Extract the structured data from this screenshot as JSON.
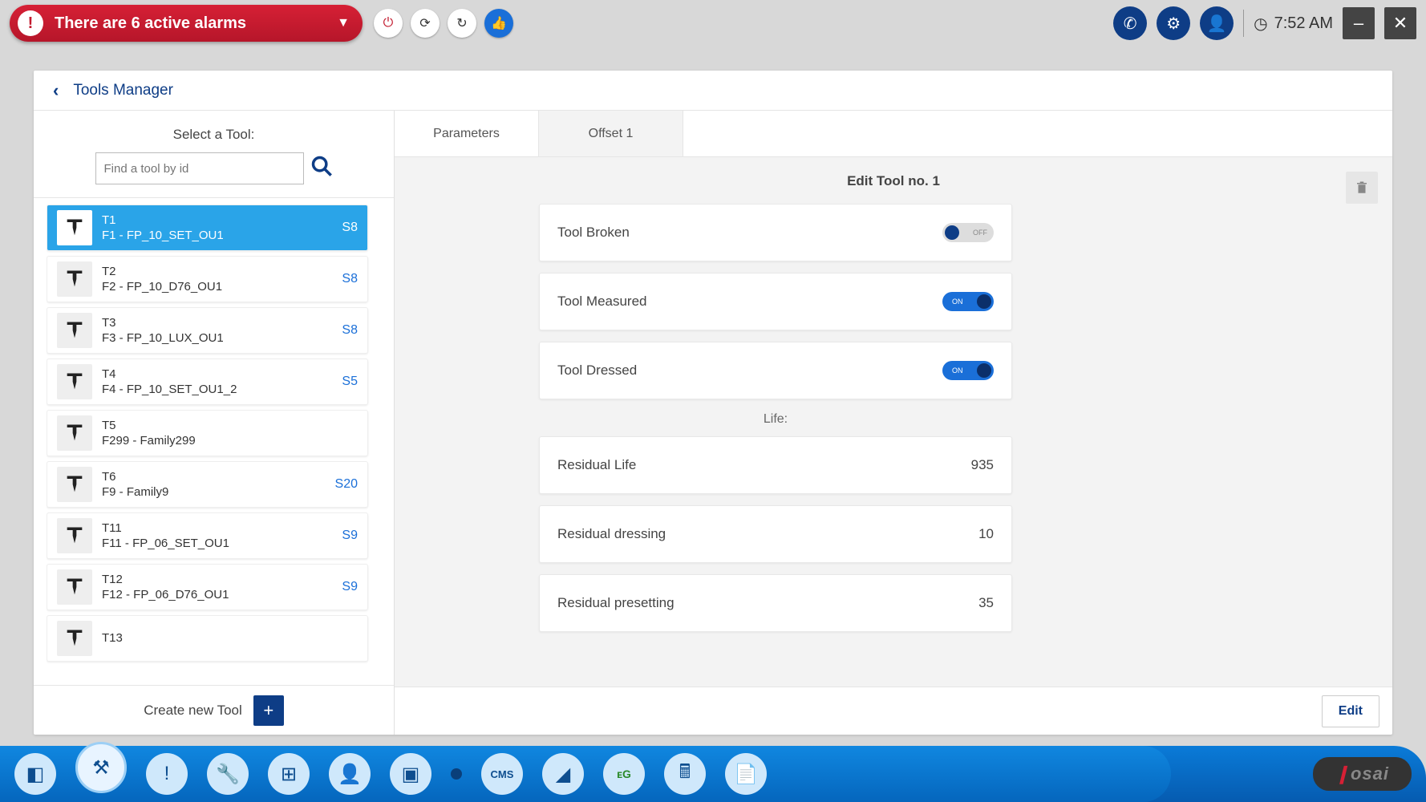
{
  "topbar": {
    "alarm_text": "There are 6 active alarms",
    "clock": "7:52 AM"
  },
  "breadcrumb": {
    "title": "Tools Manager"
  },
  "left": {
    "header": "Select a Tool:",
    "search_placeholder": "Find a tool by id",
    "create_label": "Create new Tool",
    "tools": [
      {
        "id": "T1",
        "family": "F1 - FP_10_SET_OU1",
        "slot": "S8",
        "selected": true
      },
      {
        "id": "T2",
        "family": "F2 - FP_10_D76_OU1",
        "slot": "S8"
      },
      {
        "id": "T3",
        "family": "F3 - FP_10_LUX_OU1",
        "slot": "S8"
      },
      {
        "id": "T4",
        "family": "F4 - FP_10_SET_OU1_2",
        "slot": "S5"
      },
      {
        "id": "T5",
        "family": "F299 - Family299",
        "slot": ""
      },
      {
        "id": "T6",
        "family": "F9 - Family9",
        "slot": "S20"
      },
      {
        "id": "T11",
        "family": "F11 - FP_06_SET_OU1",
        "slot": "S9"
      },
      {
        "id": "T12",
        "family": "F12 - FP_06_D76_OU1",
        "slot": "S9"
      },
      {
        "id": "T13",
        "family": "",
        "slot": ""
      }
    ]
  },
  "tabs": {
    "tab1": "Parameters",
    "tab2": "Offset 1"
  },
  "detail": {
    "title": "Edit Tool no. 1",
    "tool_broken": {
      "label": "Tool Broken",
      "state": "OFF"
    },
    "tool_measured": {
      "label": "Tool Measured",
      "state": "ON"
    },
    "tool_dressed": {
      "label": "Tool Dressed",
      "state": "ON"
    },
    "life_header": "Life:",
    "residual_life": {
      "label": "Residual Life",
      "value": "935"
    },
    "residual_dressing": {
      "label": "Residual dressing",
      "value": "10"
    },
    "residual_presetting": {
      "label": "Residual presetting",
      "value": "35"
    },
    "edit_button": "Edit"
  },
  "brand": "osai"
}
